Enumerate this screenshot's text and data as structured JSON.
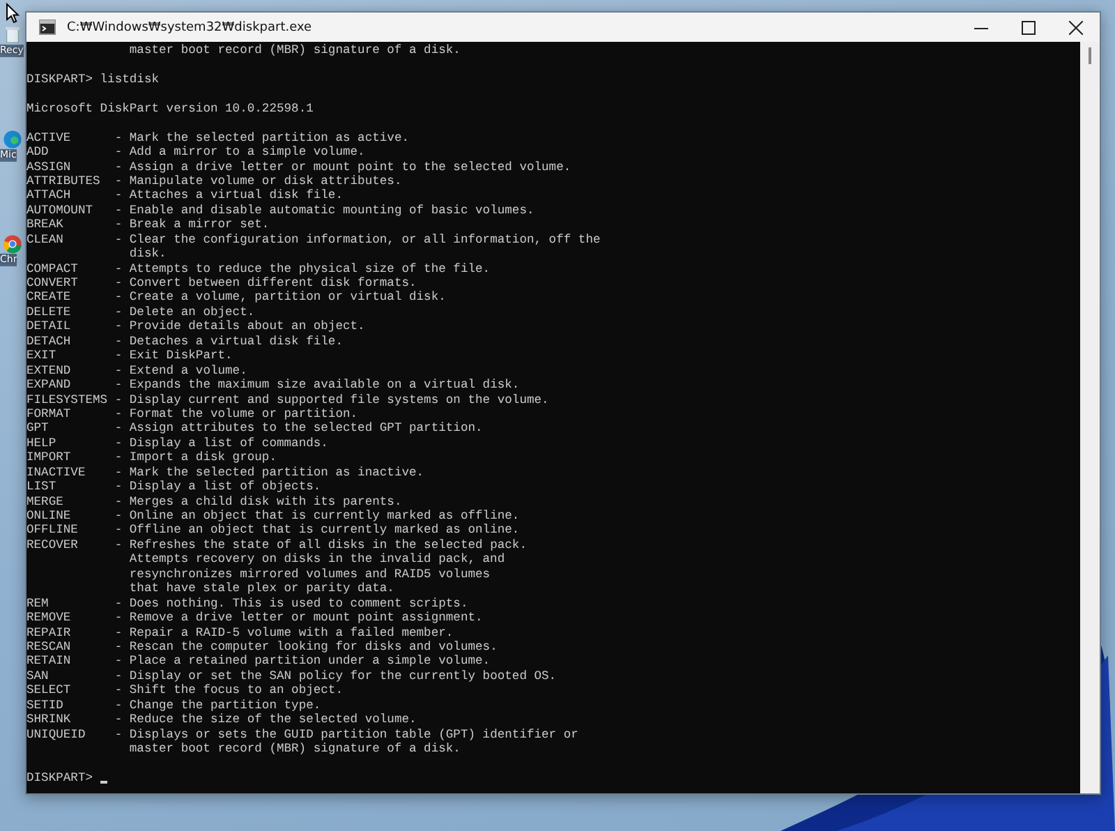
{
  "desktop_icons": [
    {
      "label": "Recy",
      "kind": "bin"
    },
    {
      "label": "Mic",
      "kind": "edge"
    },
    {
      "label": "Chr",
      "kind": "chrome"
    }
  ],
  "window": {
    "title": "C:₩Windows₩system32₩diskpart.exe"
  },
  "console": {
    "scrollback_tail": [
      "master boot record (MBR) signature of a disk."
    ],
    "command_prompt": {
      "prompt": "DISKPART>",
      "command": "listdisk"
    },
    "version": "Microsoft DiskPart version 10.0.22598.1",
    "commands": [
      {
        "name": "ACTIVE",
        "description": [
          "- Mark the selected partition as active."
        ]
      },
      {
        "name": "ADD",
        "description": [
          "- Add a mirror to a simple volume."
        ]
      },
      {
        "name": "ASSIGN",
        "description": [
          "- Assign a drive letter or mount point to the selected volume."
        ]
      },
      {
        "name": "ATTRIBUTES",
        "description": [
          "- Manipulate volume or disk attributes."
        ]
      },
      {
        "name": "ATTACH",
        "description": [
          "- Attaches a virtual disk file."
        ]
      },
      {
        "name": "AUTOMOUNT",
        "description": [
          "- Enable and disable automatic mounting of basic volumes."
        ]
      },
      {
        "name": "BREAK",
        "description": [
          "- Break a mirror set."
        ]
      },
      {
        "name": "CLEAN",
        "description": [
          "- Clear the configuration information, or all information, off the",
          "disk."
        ]
      },
      {
        "name": "COMPACT",
        "description": [
          "- Attempts to reduce the physical size of the file."
        ]
      },
      {
        "name": "CONVERT",
        "description": [
          "- Convert between different disk formats."
        ]
      },
      {
        "name": "CREATE",
        "description": [
          "- Create a volume, partition or virtual disk."
        ]
      },
      {
        "name": "DELETE",
        "description": [
          "- Delete an object."
        ]
      },
      {
        "name": "DETAIL",
        "description": [
          "- Provide details about an object."
        ]
      },
      {
        "name": "DETACH",
        "description": [
          "- Detaches a virtual disk file."
        ]
      },
      {
        "name": "EXIT",
        "description": [
          "- Exit DiskPart."
        ]
      },
      {
        "name": "EXTEND",
        "description": [
          "- Extend a volume."
        ]
      },
      {
        "name": "EXPAND",
        "description": [
          "- Expands the maximum size available on a virtual disk."
        ]
      },
      {
        "name": "FILESYSTEMS",
        "description": [
          "- Display current and supported file systems on the volume."
        ]
      },
      {
        "name": "FORMAT",
        "description": [
          "- Format the volume or partition."
        ]
      },
      {
        "name": "GPT",
        "description": [
          "- Assign attributes to the selected GPT partition."
        ]
      },
      {
        "name": "HELP",
        "description": [
          "- Display a list of commands."
        ]
      },
      {
        "name": "IMPORT",
        "description": [
          "- Import a disk group."
        ]
      },
      {
        "name": "INACTIVE",
        "description": [
          "- Mark the selected partition as inactive."
        ]
      },
      {
        "name": "LIST",
        "description": [
          "- Display a list of objects."
        ]
      },
      {
        "name": "MERGE",
        "description": [
          "- Merges a child disk with its parents."
        ]
      },
      {
        "name": "ONLINE",
        "description": [
          "- Online an object that is currently marked as offline."
        ]
      },
      {
        "name": "OFFLINE",
        "description": [
          "- Offline an object that is currently marked as online."
        ]
      },
      {
        "name": "RECOVER",
        "description": [
          "- Refreshes the state of all disks in the selected pack.",
          "Attempts recovery on disks in the invalid pack, and",
          "resynchronizes mirrored volumes and RAID5 volumes",
          "that have stale plex or parity data."
        ]
      },
      {
        "name": "REM",
        "description": [
          "- Does nothing. This is used to comment scripts."
        ]
      },
      {
        "name": "REMOVE",
        "description": [
          "- Remove a drive letter or mount point assignment."
        ]
      },
      {
        "name": "REPAIR",
        "description": [
          "- Repair a RAID-5 volume with a failed member."
        ]
      },
      {
        "name": "RESCAN",
        "description": [
          "- Rescan the computer looking for disks and volumes."
        ]
      },
      {
        "name": "RETAIN",
        "description": [
          "- Place a retained partition under a simple volume."
        ]
      },
      {
        "name": "SAN",
        "description": [
          "- Display or set the SAN policy for the currently booted OS."
        ]
      },
      {
        "name": "SELECT",
        "description": [
          "- Shift the focus to an object."
        ]
      },
      {
        "name": "SETID",
        "description": [
          "- Change the partition type."
        ]
      },
      {
        "name": "SHRINK",
        "description": [
          "- Reduce the size of the selected volume."
        ]
      },
      {
        "name": "UNIQUEID",
        "description": [
          "- Displays or sets the GUID partition table (GPT) identifier or",
          "master boot record (MBR) signature of a disk."
        ]
      }
    ],
    "current_prompt": "DISKPART>"
  }
}
